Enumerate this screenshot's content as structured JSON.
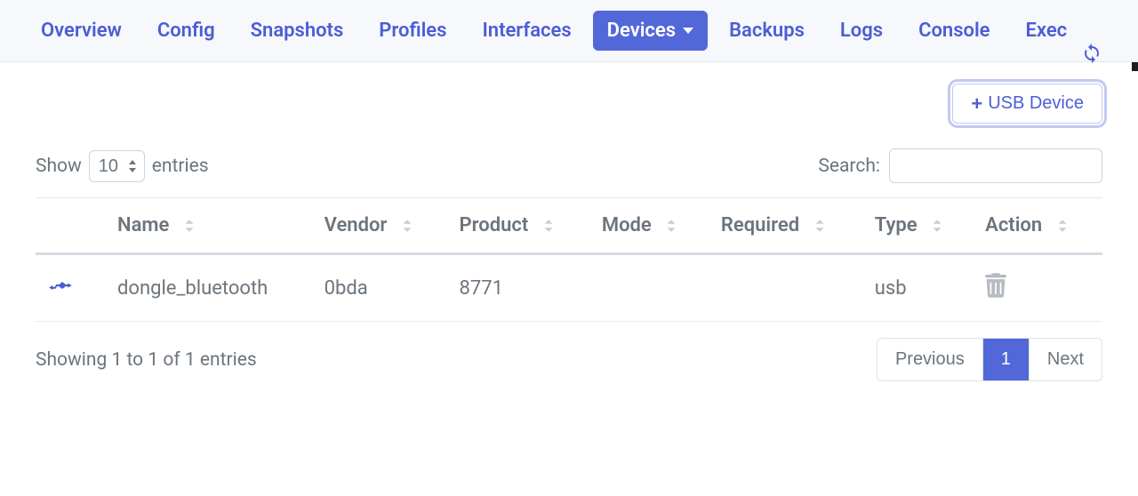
{
  "nav": {
    "items": [
      {
        "label": "Overview"
      },
      {
        "label": "Config"
      },
      {
        "label": "Snapshots"
      },
      {
        "label": "Profiles"
      },
      {
        "label": "Interfaces"
      },
      {
        "label": "Devices"
      },
      {
        "label": "Backups"
      },
      {
        "label": "Logs"
      },
      {
        "label": "Console"
      },
      {
        "label": "Exec"
      }
    ]
  },
  "actions": {
    "usb_button_label": "USB Device"
  },
  "table": {
    "length": {
      "show": "Show",
      "entries": "entries",
      "value": "10"
    },
    "search": {
      "label": "Search:",
      "value": ""
    },
    "columns": {
      "blank": "",
      "name": "Name",
      "vendor": "Vendor",
      "product": "Product",
      "mode": "Mode",
      "required": "Required",
      "type": "Type",
      "action": "Action"
    },
    "rows": [
      {
        "name": "dongle_bluetooth",
        "vendor": "0bda",
        "product": "8771",
        "mode": "",
        "required": "",
        "type": "usb"
      }
    ],
    "info": "Showing 1 to 1 of 1 entries",
    "pagination": {
      "prev": "Previous",
      "page": "1",
      "next": "Next"
    }
  }
}
